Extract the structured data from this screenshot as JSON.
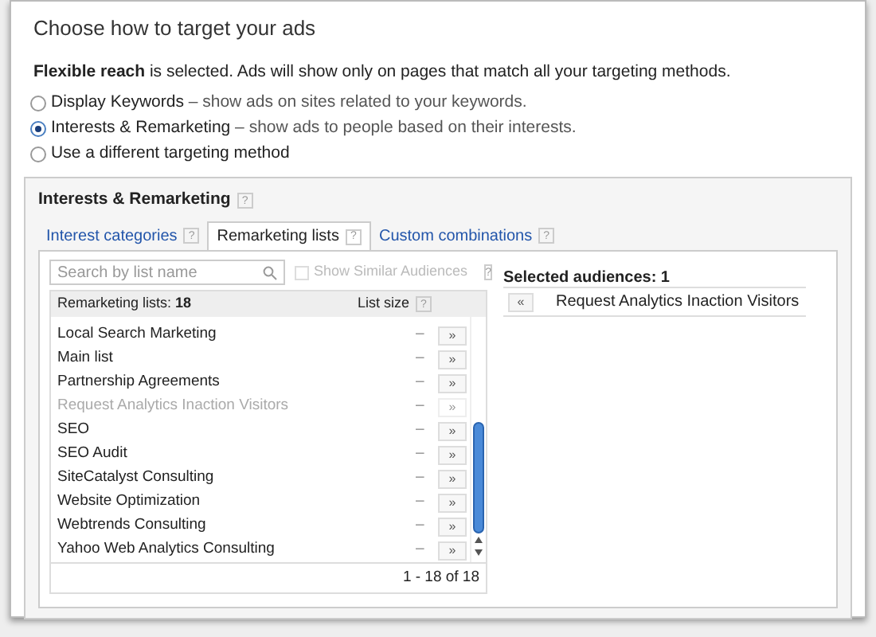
{
  "title": "Choose how to target your ads",
  "reach_note": "**Flexible reach** is selected. Ads will show only on pages that match all your targeting methods.",
  "methods": [
    {
      "label": "Display Keywords",
      "desc": " – show ads on sites related to your keywords.",
      "selected": false
    },
    {
      "label": "Interests & Remarketing",
      "desc": " – show ads to people based on their interests.",
      "selected": true
    },
    {
      "label": "Use a different targeting method",
      "selected": false
    }
  ],
  "panel": {
    "title": "Interests & Remarketing",
    "help": "?"
  },
  "tabs": [
    {
      "label": "Interest categories",
      "help": "?",
      "selected": false
    },
    {
      "label": "Remarketing lists",
      "help": "?",
      "selected": true
    },
    {
      "label": "Custom combinations",
      "help": "?",
      "selected": false
    }
  ],
  "search": {
    "placeholder": "Search by list name"
  },
  "similar": {
    "label": "Show Similar Audiences",
    "help": "?",
    "checked": false,
    "disabled": true
  },
  "list": {
    "header": "Remarketing lists: **18**",
    "size_header": "List size",
    "help": "?",
    "footer": "1 - 18 of 18",
    "rows": [
      {
        "name": "Local Search Marketing",
        "size": "–",
        "add": "»",
        "disabled": false
      },
      {
        "name": "Main list",
        "size": "–",
        "add": "»",
        "disabled": false
      },
      {
        "name": "Partnership Agreements",
        "size": "–",
        "add": "»",
        "disabled": false
      },
      {
        "name": "Request Analytics Inaction Visitors",
        "size": "–",
        "add": "»",
        "disabled": true
      },
      {
        "name": "SEO",
        "size": "–",
        "add": "»",
        "disabled": false
      },
      {
        "name": "SEO Audit",
        "size": "–",
        "add": "»",
        "disabled": false
      },
      {
        "name": "SiteCatalyst Consulting",
        "size": "–",
        "add": "»",
        "disabled": false
      },
      {
        "name": "Website Optimization",
        "size": "–",
        "add": "»",
        "disabled": false
      },
      {
        "name": "Webtrends Consulting",
        "size": "–",
        "add": "»",
        "disabled": false
      },
      {
        "name": "Yahoo Web Analytics Consulting",
        "size": "–",
        "add": "»",
        "disabled": false
      }
    ]
  },
  "selected_audiences": {
    "header": "Selected audiences: 1",
    "items": [
      {
        "name": "Request Analytics Inaction Visitors",
        "remove": "«"
      }
    ]
  }
}
